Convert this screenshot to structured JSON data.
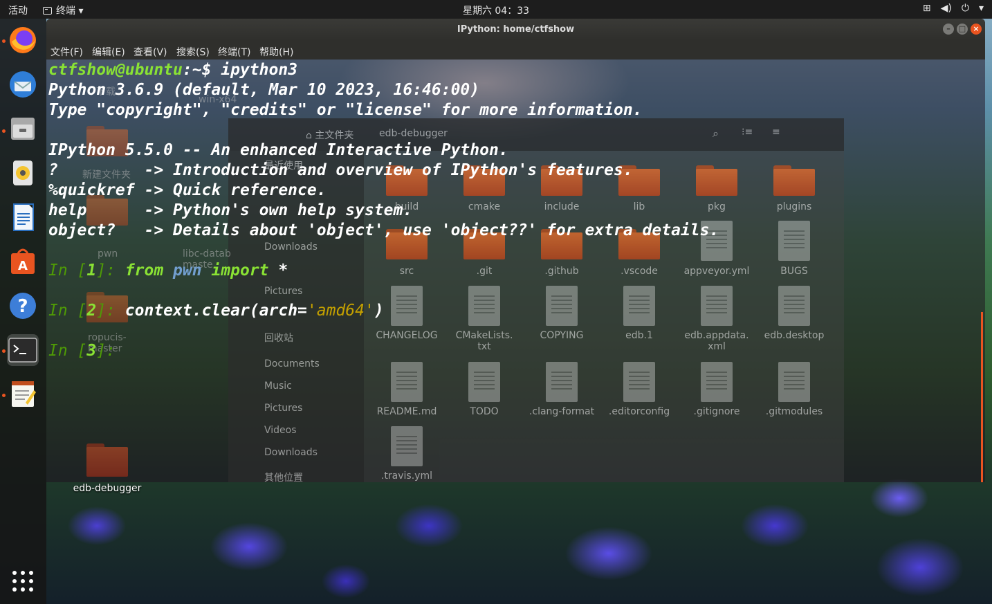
{
  "topbar": {
    "activities": "活动",
    "app_name": "终端 ▾",
    "clock": "星期六 04：33",
    "tray": {
      "network": "⊞",
      "volume": "◀)",
      "power": "⏻",
      "menu": "▾"
    }
  },
  "window": {
    "title": "IPython: home/ctfshow",
    "menu": [
      "文件(F)",
      "编辑(E)",
      "查看(V)",
      "搜索(S)",
      "终端(T)",
      "帮助(H)"
    ]
  },
  "terminal": {
    "prompt_user": "ctfshow@ubuntu",
    "prompt_path": ":~$",
    "command": " ipython3",
    "banner1": "Python 3.6.9 (default, Mar 10 2023, 16:46:00)",
    "banner2": "Type \"copyright\", \"credits\" or \"license\" for more information.",
    "banner3": "IPython 5.5.0 -- An enhanced Interactive Python.",
    "help_lines": [
      "?         -> Introduction and overview of IPython's features.",
      "%quickref -> Quick reference.",
      "help      -> Python's own help system.",
      "object?   -> Details about 'object', use 'object??' for extra details."
    ],
    "in1_prefix": "In [",
    "in1_num": "1",
    "in1_suffix": "]: ",
    "in1_from": "from",
    "in1_mod": " pwn ",
    "in1_import": "import",
    "in1_star": " *",
    "in2_prefix": "In [",
    "in2_num": "2",
    "in2_suffix": "]: ",
    "in2_code": "context.clear(arch=",
    "in2_str": "'amd64'",
    "in2_end": ")",
    "in3_prefix": "In [",
    "in3_num": "3",
    "in3_suffix": "]: "
  },
  "ghost_fm": {
    "breadcrumb_home": "⌂ 主文件夹",
    "breadcrumb_dir": "edb-debugger",
    "sidebar": [
      "最近使用",
      "主目录",
      "Desktop",
      "Downloads",
      "Music",
      "Pictures",
      "Videos",
      "回收站",
      "Documents",
      "Music",
      "Pictures",
      "Videos",
      "Downloads",
      "其他位置"
    ],
    "folders": [
      "build",
      "cmake",
      "include",
      "lib",
      "pkg",
      "plugins",
      "src",
      ".git",
      ".github",
      ".vscode"
    ],
    "files": [
      "appveyor.yml",
      "BUGS",
      "CHANGELOG",
      "CMakeLists.\ntxt",
      "COPYING",
      "edb.1",
      "edb.appdata.\nxml",
      "edb.desktop",
      "README.md",
      "TODO",
      ".clang-format",
      ".editorconfig",
      ".gitignore",
      ".gitmodules",
      ".travis.yml"
    ]
  },
  "desktop": {
    "folder_label": "edb-debugger",
    "ghost_labels": [
      "下载",
      "win-x64",
      "新建文件夹",
      "pwn",
      "libc-datab\nmaste",
      "ropucis-\nmaster"
    ]
  },
  "colors": {
    "accent": "#e95420",
    "prompt_green": "#8ae234",
    "prompt_blue": "#729fcf",
    "string_orange": "#c4a000"
  }
}
